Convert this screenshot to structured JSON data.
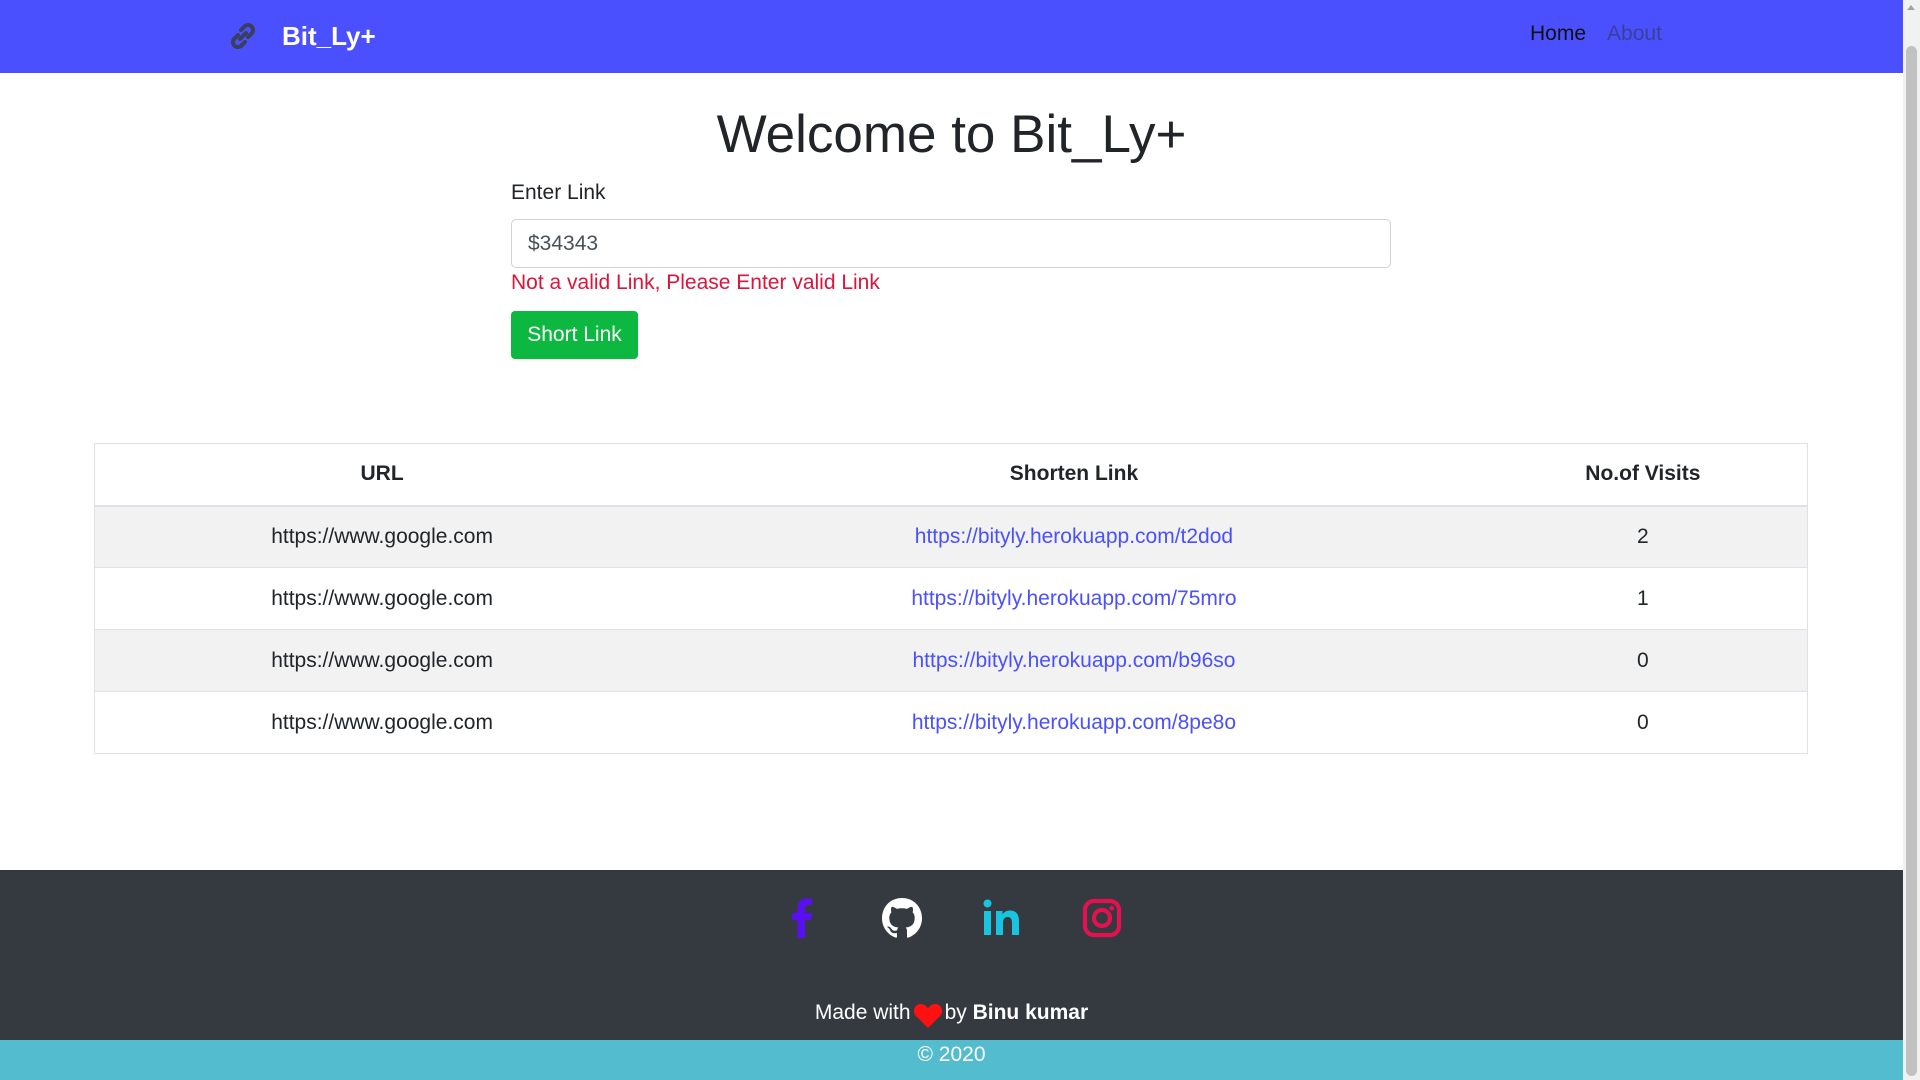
{
  "navbar": {
    "brand": "Bit_Ly+",
    "brand_icon": "link-icon",
    "links": [
      {
        "label": "Home",
        "active": true
      },
      {
        "label": "About",
        "active": false
      }
    ],
    "background": "#4b50ff"
  },
  "main": {
    "title": "Welcome to Bit_Ly+",
    "input_label": "Enter Link",
    "input_value": "$34343",
    "error": "Not a valid Link, Please Enter valid Link",
    "submit_label": "Short Link",
    "error_color": "#dc143c",
    "button_color": "#0db840"
  },
  "table": {
    "headers": [
      "URL",
      "Shorten Link",
      "No.of Visits"
    ],
    "rows": [
      {
        "url": "https://www.google.com",
        "short": "https://bityly.herokuapp.com/t2dod",
        "visits": "2"
      },
      {
        "url": "https://www.google.com",
        "short": "https://bityly.herokuapp.com/75mro",
        "visits": "1"
      },
      {
        "url": "https://www.google.com",
        "short": "https://bityly.herokuapp.com/b96so",
        "visits": "0"
      },
      {
        "url": "https://www.google.com",
        "short": "https://bityly.herokuapp.com/8pe8o",
        "visits": "0"
      }
    ]
  },
  "footer": {
    "social": [
      {
        "icon": "facebook-icon",
        "color": "#5a0ff2"
      },
      {
        "icon": "github-icon",
        "color": "#ffffff"
      },
      {
        "icon": "linkedin-icon",
        "color": "#17c5e0"
      },
      {
        "icon": "instagram-icon",
        "color": "#e3124f"
      }
    ],
    "made_with": "Made with",
    "by": "by",
    "author": "Binu kumar",
    "copyright": "© 2020",
    "background": "#343a40",
    "copyright_background": "#54bccf"
  }
}
